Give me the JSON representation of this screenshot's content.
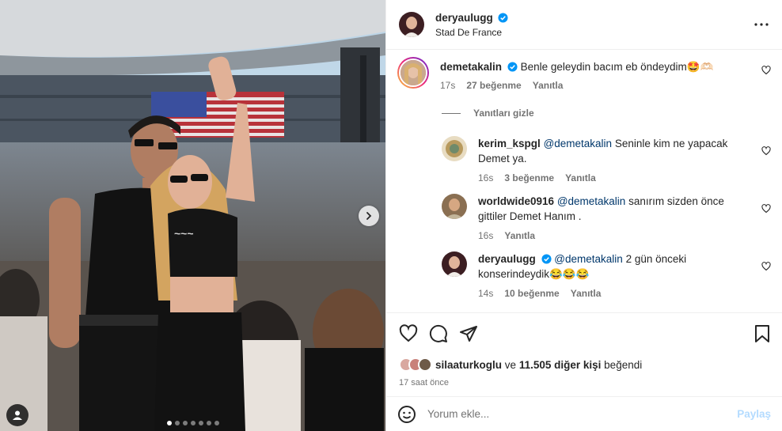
{
  "post": {
    "author": "deryaulugg",
    "location": "Stad De France",
    "carousel": {
      "slide_count": 7,
      "active_slide": 1
    }
  },
  "comments": [
    {
      "user": "demetakalin",
      "verified": true,
      "text": "Benle geleydin bacım eb öndeydim🤩🫶🏻",
      "time": "17s",
      "likes": "27 beğenme",
      "reply": "Yanıtla",
      "hide_replies": "Yanıtları gizle"
    }
  ],
  "replies": [
    {
      "user": "kerim_kspgl",
      "mention": "@demetakalin",
      "text_line1": "Seninle kim ne yapacak",
      "text_line2": "Demet ya.",
      "time": "16s",
      "likes": "3 beğenme",
      "reply": "Yanıtla"
    },
    {
      "user": "worldwide0916",
      "mention": "@demetakalin",
      "text_line1": "sanırım sizden önce",
      "text_line2": "gittiler Demet Hanım .",
      "time": "16s",
      "reply": "Yanıtla"
    },
    {
      "user": "deryaulugg",
      "verified": true,
      "mention": "@demetakalin",
      "text_line1": "2 gün önceki",
      "text_line2": "konserindeydik😂😂😂",
      "time": "14s",
      "likes": "10 beğenme",
      "reply": "Yanıtla"
    }
  ],
  "likes_summary": {
    "liker": "silaaturkoglu",
    "connector": "ve",
    "others": "11.505 diğer kişi",
    "suffix": "beğendi"
  },
  "posted_ago": "17 saat önce",
  "comment_input": {
    "placeholder": "Yorum ekle...",
    "post_label": "Paylaş"
  },
  "icons": [
    "verified-icon",
    "more-options-icon",
    "heart-icon",
    "comment-icon",
    "share-icon",
    "bookmark-icon",
    "emoji-icon",
    "chevron-right-icon",
    "user-tag-icon"
  ],
  "colors": {
    "verified": "#0095f6",
    "mention": "#00376b",
    "muted": "#737373",
    "post_button_disabled": "#b3dbff"
  }
}
